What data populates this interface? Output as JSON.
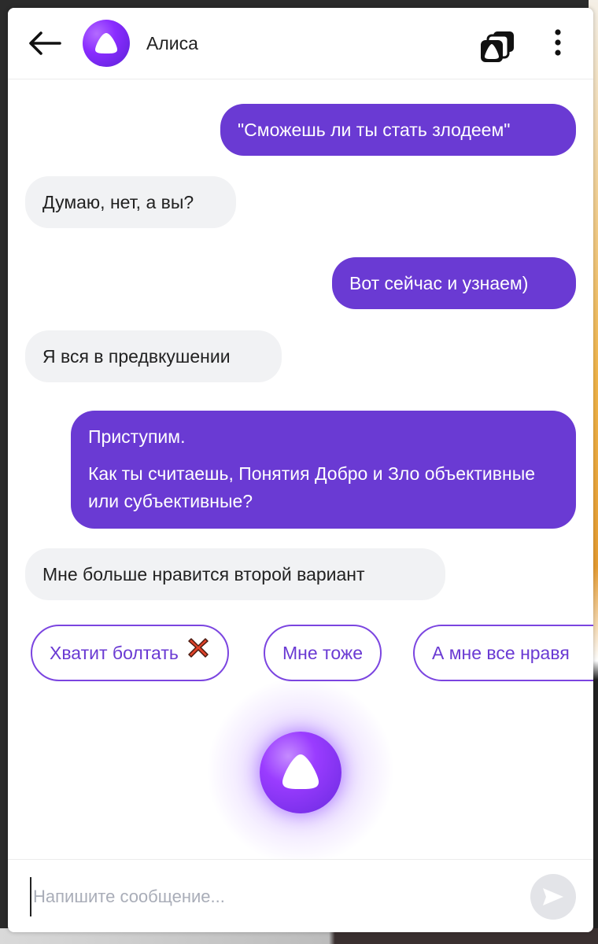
{
  "header": {
    "title": "Алиса",
    "back_icon": "arrow-left-icon",
    "cards_icon": "cards-stack-icon",
    "more_icon": "more-vertical-icon"
  },
  "messages": [
    {
      "from": "user",
      "text": "\"Сможешь ли ты стать злодеем\""
    },
    {
      "from": "bot",
      "text": "Думаю, нет, а вы?"
    },
    {
      "from": "user",
      "text": "Вот сейчас и узнаем)"
    },
    {
      "from": "bot",
      "text": "Я вся в предвкушении"
    },
    {
      "from": "user",
      "text": "Приступим.",
      "text2": "Как ты считаешь, Понятия Добро и Зло объективные или субъективные?"
    },
    {
      "from": "bot",
      "text": "Мне больше нравится второй вариант"
    }
  ],
  "suggestions": [
    {
      "label": "Хватит болтать",
      "icon": "cross-mark-icon"
    },
    {
      "label": "Мне тоже"
    },
    {
      "label": "А мне все нравя"
    }
  ],
  "input": {
    "placeholder": "Напишите сообщение...",
    "value": ""
  },
  "colors": {
    "user_bubble": "#6a3ad3",
    "bot_bubble": "#f1f2f4",
    "accent": "#7b45e0"
  }
}
